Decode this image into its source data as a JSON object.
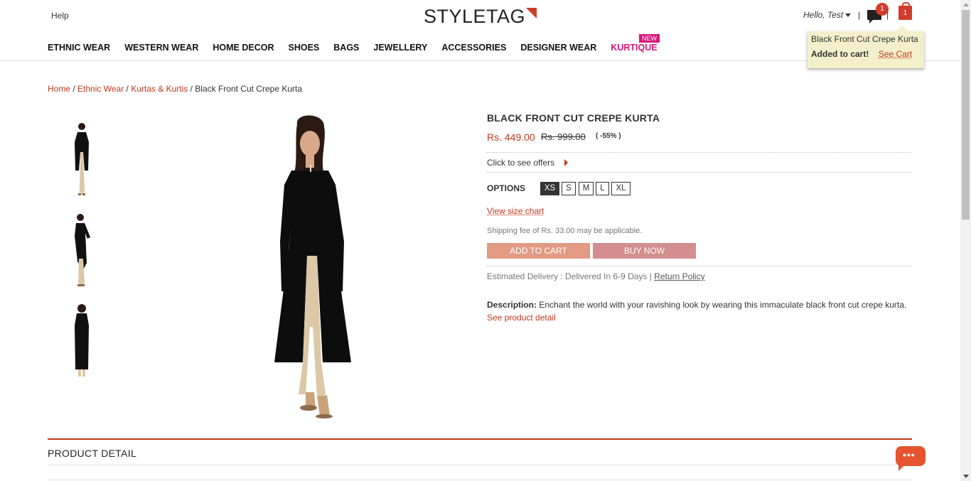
{
  "header": {
    "help": "Help",
    "logo": "STYLETAG",
    "greeting": "Hello, Test",
    "messages_count": "1",
    "cart_count": "1"
  },
  "nav": {
    "items": [
      "ETHNIC WEAR",
      "WESTERN WEAR",
      "HOME DECOR",
      "SHOES",
      "BAGS",
      "JEWELLERY",
      "ACCESSORIES",
      "DESIGNER WEAR",
      "KURTIQUE"
    ],
    "new_badge": "NEW"
  },
  "cart_popup": {
    "product": "Black Front Cut Crepe Kurta",
    "message": "Added to cart!",
    "see_cart": "See Cart"
  },
  "breadcrumb": {
    "home": "Home",
    "category": "Ethnic Wear",
    "subcategory": "Kurtas & Kurtis",
    "current": "Black Front Cut Crepe Kurta",
    "separator": "/"
  },
  "product": {
    "title": "BLACK FRONT CUT CREPE KURTA",
    "price": "Rs. 449.00",
    "old_price": "Rs. 999.00",
    "discount": "( -55% )",
    "offers": "Click to see offers",
    "options_label": "OPTIONS",
    "sizes": [
      "XS",
      "S",
      "M",
      "L",
      "XL"
    ],
    "selected_size": "XS",
    "size_chart": "View size chart",
    "shipping": "Shipping fee of Rs. 33.00 may be applicable.",
    "add_to_cart": "ADD TO CART",
    "buy_now": "BUY NOW",
    "delivery": "Estimated Delivery : Delivered In 6-9 Days |",
    "return_policy": "Return Policy",
    "description_label": "Description:",
    "description": "Enchant the world with your ravishing look by wearing this immaculate black front cut crepe kurta.",
    "see_detail": "See product detail"
  },
  "sections": {
    "product_detail": "PRODUCT DETAIL"
  },
  "colors": {
    "accent": "#c0391b",
    "kurtique": "#d6177a",
    "add_to_cart_bg": "#e29a84",
    "buy_now_bg": "#d48e8e"
  }
}
